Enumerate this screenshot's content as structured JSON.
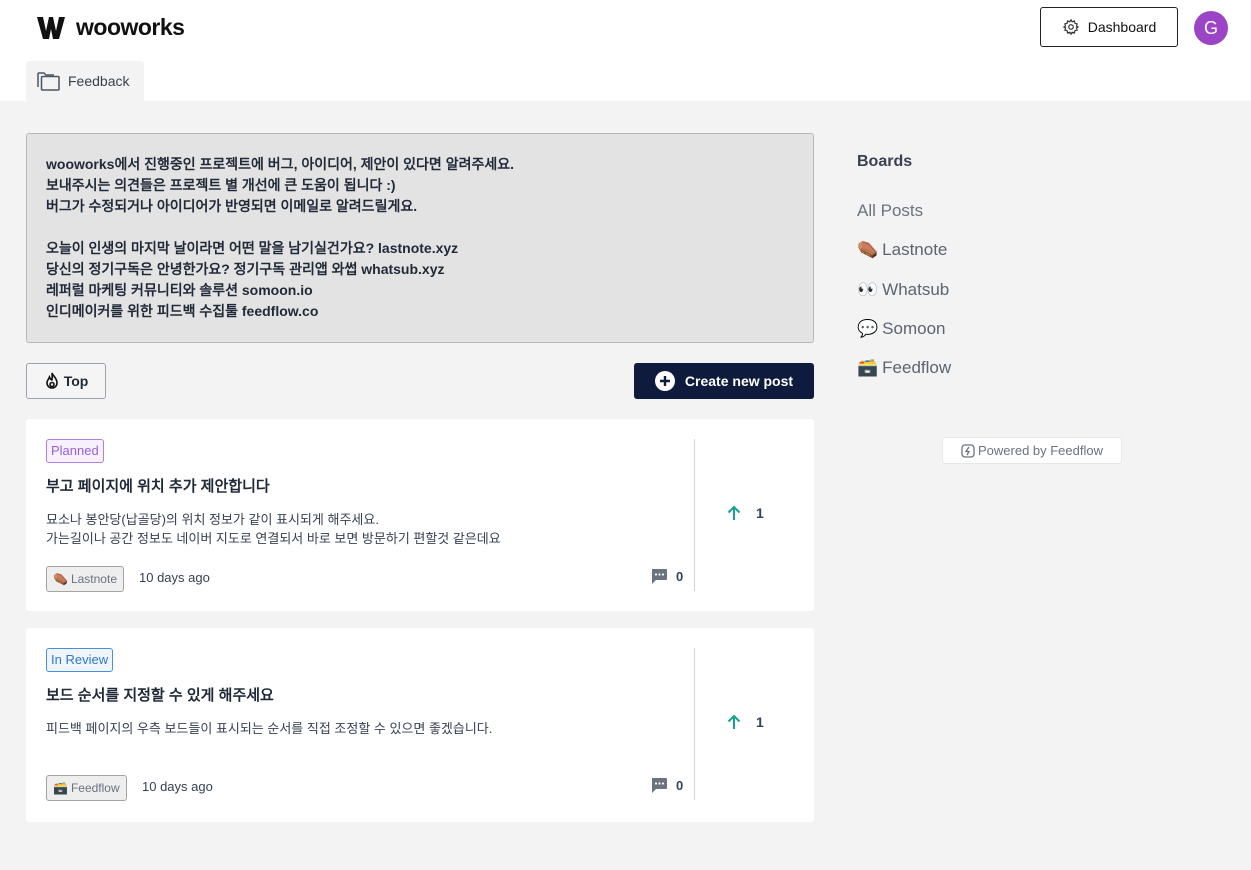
{
  "header": {
    "logo_text": "wooworks",
    "dashboard_label": "Dashboard",
    "avatar_initial": "G"
  },
  "nav": {
    "feedback_tab": "Feedback"
  },
  "notice": {
    "lines": [
      "wooworks에서 진행중인 프로젝트에 버그, 아이디어, 제안이 있다면 알려주세요.",
      "보내주시는 의견들은 프로젝트 별 개선에 큰 도움이 됩니다 :)",
      "버그가 수정되거나 아이디어가 반영되면 이메일로 알려드릴게요.",
      "",
      "오늘이 인생의 마지막 날이라면 어떤 말을 남기실건가요? lastnote.xyz",
      "당신의 정기구독은 안녕한가요? 정기구독 관리앱 와썹 whatsub.xyz",
      "레퍼럴 마케팅 커뮤니티와 솔루션 somoon.io",
      "인디메이커를 위한 피드백 수집툴 feedflow.co"
    ]
  },
  "toolbar": {
    "sort_label": "Top",
    "create_label": "Create new post"
  },
  "posts": [
    {
      "status": "Planned",
      "title": "부고 페이지에 위치 추가 제안합니다",
      "desc_lines": [
        "묘소나 봉안당(납골당)의 위치 정보가 같이 표시되게 해주세요.",
        "가는길이나 공간 정보도 네이버 지도로 연결되서 바로 보면 방문하기 편할것 같은데요"
      ],
      "board": "Lastnote",
      "board_emoji": "⚰️",
      "time": "10 days ago",
      "comments": "0",
      "votes": "1"
    },
    {
      "status": "In Review",
      "title": "보드 순서를 지정할 수 있게 해주세요",
      "desc_lines": [
        "피드백 페이지의 우측 보드들이 표시되는 순서를 직접 조정할 수 있으면 좋겠습니다.",
        ""
      ],
      "board": "Feedflow",
      "board_emoji": "🗃️",
      "time": "10 days ago",
      "comments": "0",
      "votes": "1"
    }
  ],
  "sidebar": {
    "title": "Boards",
    "items": [
      {
        "emoji": "",
        "label": "All Posts"
      },
      {
        "emoji": "⚰️",
        "label": "Lastnote"
      },
      {
        "emoji": "👀",
        "label": "Whatsub"
      },
      {
        "emoji": "💬",
        "label": "Somoon"
      },
      {
        "emoji": "🗃️",
        "label": "Feedflow"
      }
    ],
    "powered_label": "Powered by Feedflow"
  },
  "colors": {
    "primary_button": "#0f1b3d",
    "avatar": "#9b44c6",
    "upvote": "#14a38b",
    "status_planned": "#9a5fd6",
    "status_review": "#2f78c8"
  }
}
